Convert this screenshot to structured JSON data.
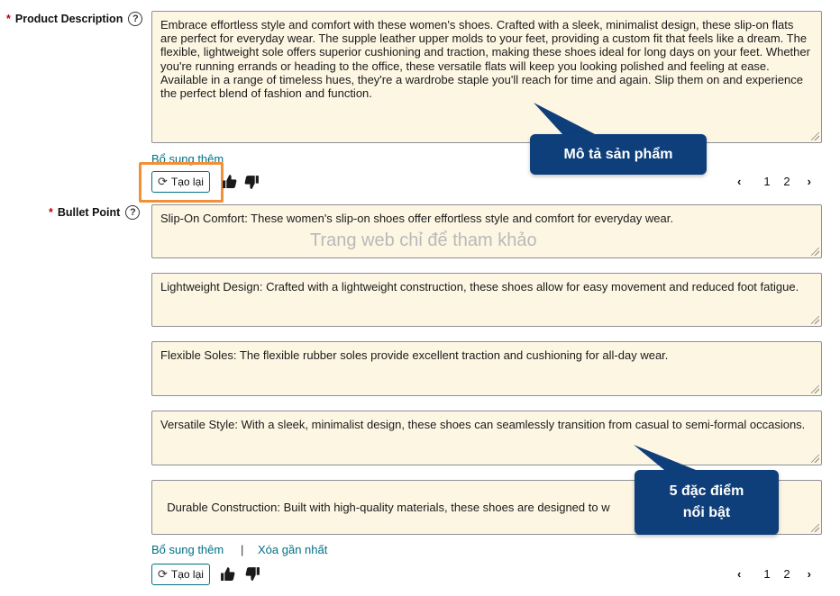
{
  "product_description": {
    "label": "Product Description",
    "help_icon": "question-circle-icon",
    "text": "Embrace effortless style and comfort with these women's shoes. Crafted with a sleek, minimalist design, these slip-on flats are perfect for everyday wear. The supple leather upper molds to your feet, providing a custom fit that feels like a dream. The flexible, lightweight sole offers superior cushioning and traction, making these shoes ideal for long days on your feet. Whether you're running errands or heading to the office, these versatile flats will keep you looking polished and feeling at ease. Available in a range of timeless hues, they're a wardrobe staple you'll reach for time and again. Slip them on and experience the perfect blend of fashion and function.",
    "add_more": "Bổ sung thêm",
    "regenerate": "Tạo lại",
    "pager": {
      "page1": "1",
      "page2": "2"
    }
  },
  "bullet_point": {
    "label": "Bullet Point",
    "help_icon": "question-circle-icon",
    "items": [
      "Slip-On Comfort: These women's slip-on shoes offer effortless style and comfort for everyday wear.",
      "Lightweight Design: Crafted with a lightweight construction, these shoes allow for easy movement and reduced foot fatigue.",
      "Flexible Soles: The flexible rubber soles provide excellent traction and cushioning for all-day wear.",
      "Versatile Style: With a sleek, minimalist design, these shoes can seamlessly transition from casual to semi-formal occasions.",
      "Durable Construction: Built with high-quality materials, these shoes are designed to w                                    wear."
    ],
    "add_more": "Bổ sung thêm",
    "separator": "|",
    "clear_latest": "Xóa gần nhất",
    "regenerate": "Tạo lại",
    "pager": {
      "page1": "1",
      "page2": "2"
    }
  },
  "watermark": "Trang web chỉ để tham khảo",
  "callouts": {
    "description": "Mô tả sản phẩm",
    "bullets_line1": "5 đặc điểm",
    "bullets_line2": "nổi bật"
  },
  "colors": {
    "link": "#007185",
    "textbox_bg": "#fdf6e3",
    "highlight": "#f0913a",
    "callout_bg": "#0e3f7a",
    "required": "#c40000"
  }
}
